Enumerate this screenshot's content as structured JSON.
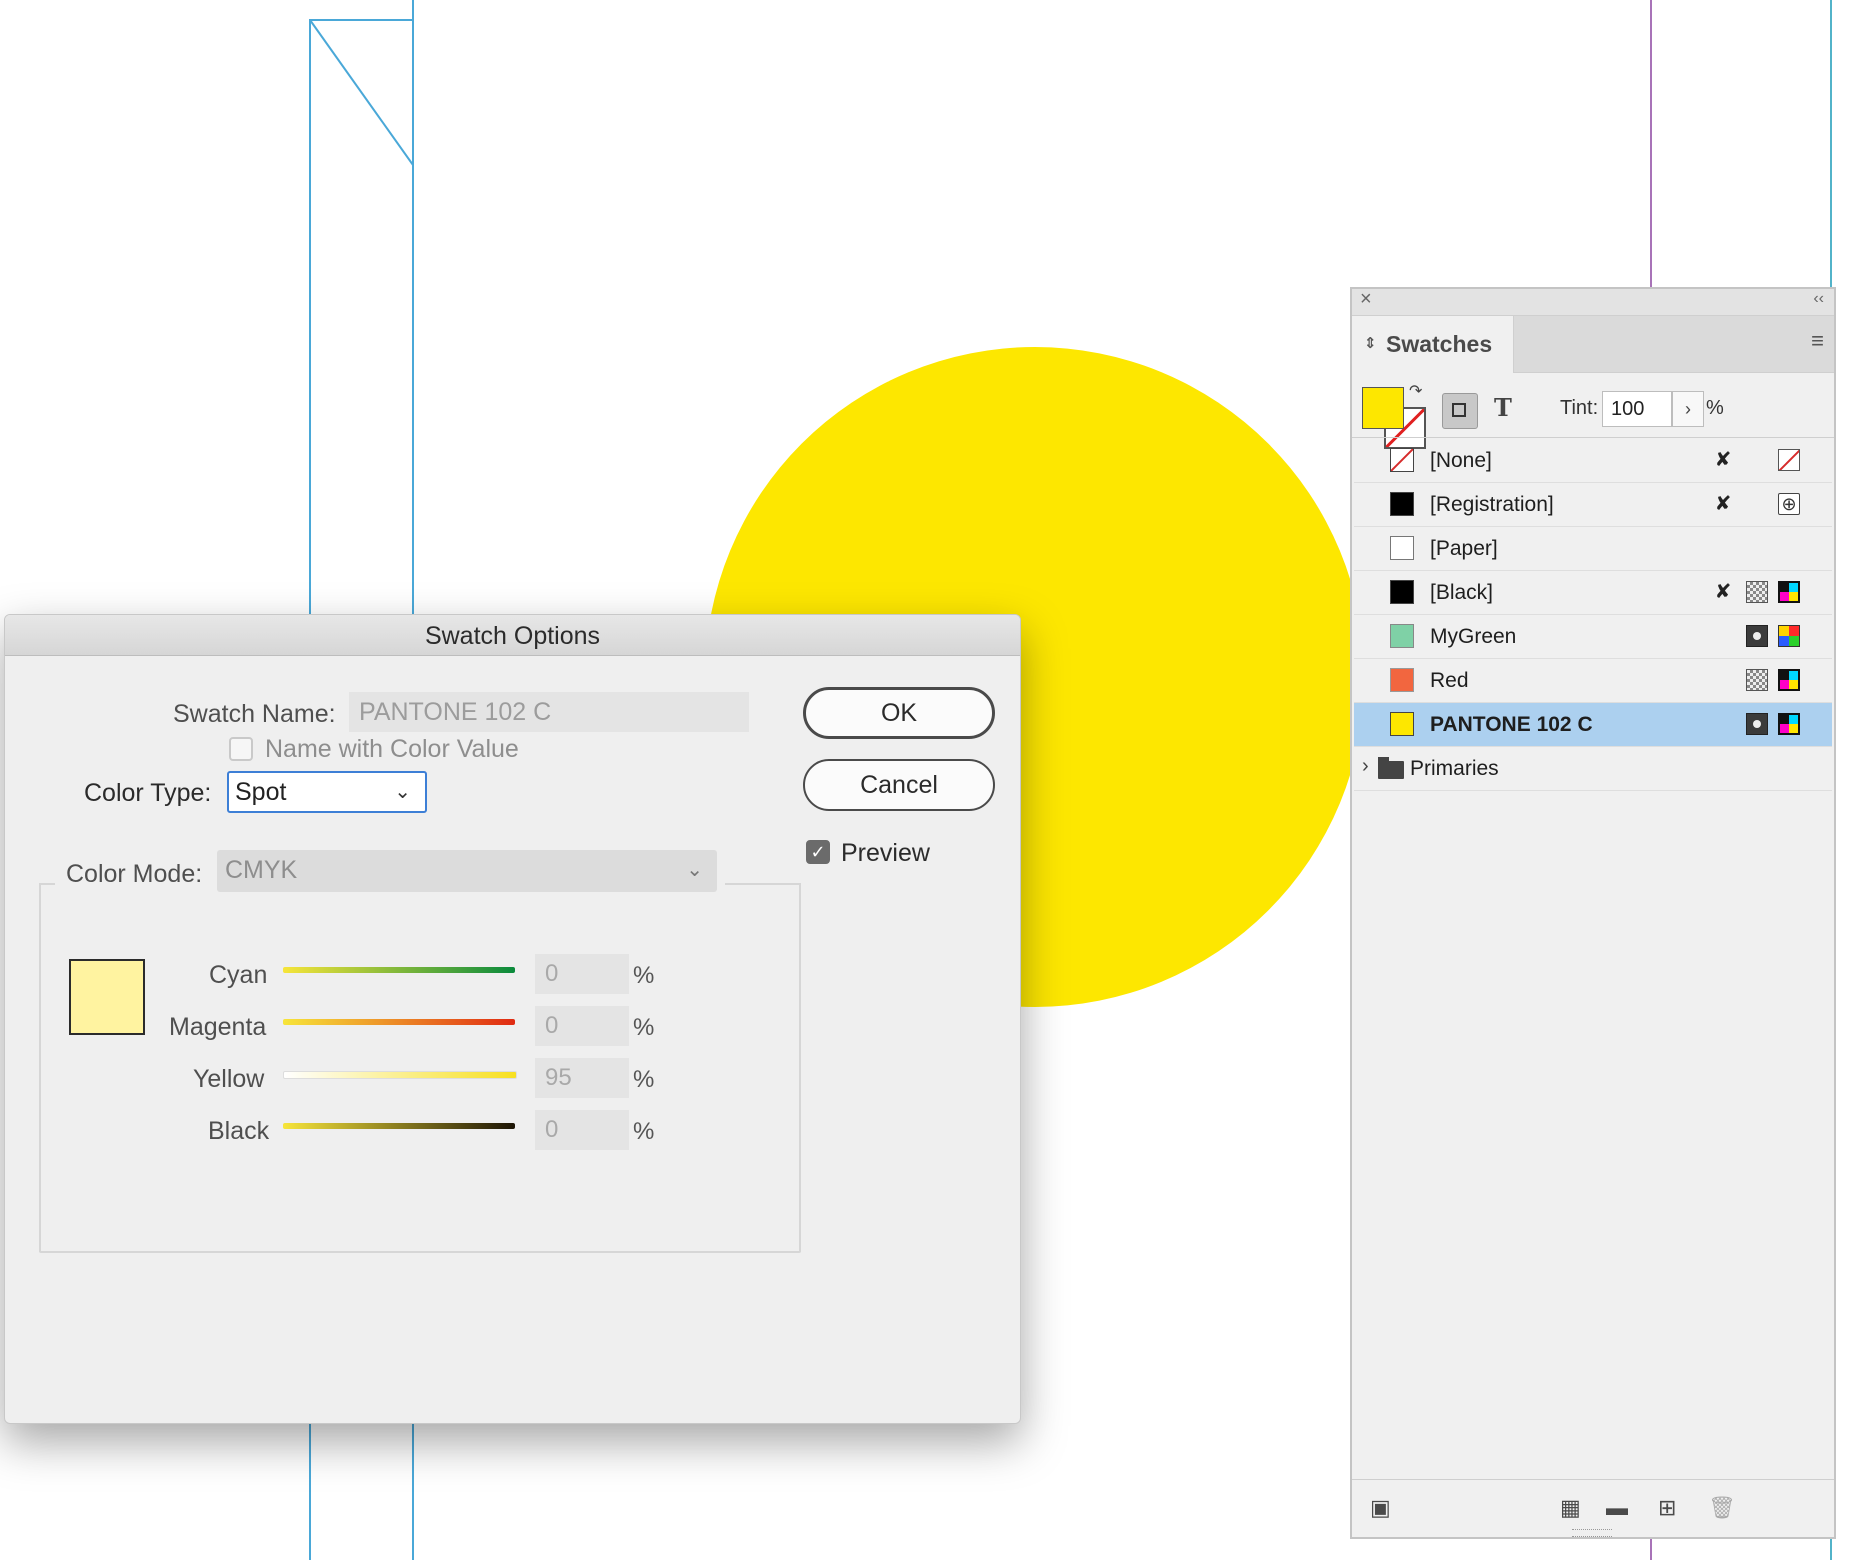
{
  "colors": {
    "accent_circle": "#fde700",
    "selected_row": "#acd0ef",
    "swatch_preview": "#fff3a0"
  },
  "dialog": {
    "title": "Swatch Options",
    "swatch_name_label": "Swatch Name:",
    "swatch_name_value": "PANTONE 102 C",
    "name_with_color_value_label": "Name with Color Value",
    "name_with_color_value_checked": false,
    "color_type_label": "Color Type:",
    "color_type_value": "Spot",
    "color_mode_label": "Color Mode:",
    "color_mode_value": "CMYK",
    "ok_label": "OK",
    "cancel_label": "Cancel",
    "preview_label": "Preview",
    "preview_checked": true,
    "percent_symbol": "%",
    "sliders": [
      {
        "name": "Cyan",
        "value": "0"
      },
      {
        "name": "Magenta",
        "value": "0"
      },
      {
        "name": "Yellow",
        "value": "95"
      },
      {
        "name": "Black",
        "value": "0"
      }
    ]
  },
  "panel": {
    "tab_label": "Swatches",
    "tint_label": "Tint:",
    "tint_value": "100",
    "tint_percent": "%",
    "swatches": [
      {
        "name": "[None]",
        "chip": "none",
        "icons": [
          "pen-crossed-icon",
          "none-icon"
        ]
      },
      {
        "name": "[Registration]",
        "chip": "#000000",
        "icons": [
          "pen-crossed-icon",
          "registration-icon"
        ]
      },
      {
        "name": "[Paper]",
        "chip": "#ffffff",
        "icons": []
      },
      {
        "name": "[Black]",
        "chip": "#000000",
        "icons": [
          "pen-crossed-icon",
          "process-icon",
          "cmyk-icon"
        ]
      },
      {
        "name": "MyGreen",
        "chip": "#7fd1a6",
        "icons": [
          "spot-icon",
          "rgb-icon"
        ]
      },
      {
        "name": "Red",
        "chip": "#f2663f",
        "icons": [
          "process-icon",
          "cmyk-icon"
        ]
      },
      {
        "name": "PANTONE 102 C",
        "chip": "#fde700",
        "icons": [
          "spot-icon",
          "cmyk-icon"
        ],
        "selected": true
      }
    ],
    "group_name": "Primaries"
  }
}
